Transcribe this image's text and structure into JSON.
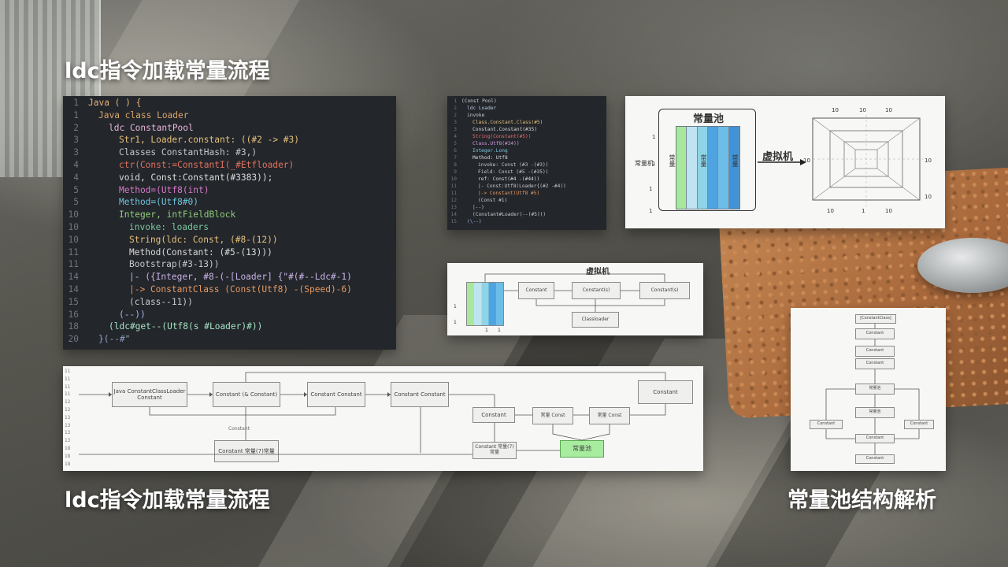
{
  "titles": {
    "top_left": "ldc指令加载常量流程",
    "bottom_left": "ldc指令加载常量流程",
    "bottom_right": "常量池结构解析"
  },
  "code_panel_main": {
    "lines": [
      {
        "num": "1",
        "text": "Java ( ) {",
        "indent": 0,
        "color": "#e0b37a"
      },
      {
        "num": "1",
        "text": "Java class Loader",
        "indent": 1,
        "color": "#d9a56c"
      },
      {
        "num": "2",
        "text": "ldc ConstantPool",
        "indent": 2,
        "color": "#e7b7d9"
      },
      {
        "num": "3",
        "text": "Str1, Loader.constant: ((#2 -> #3)",
        "indent": 3,
        "color": "#e6c07a"
      },
      {
        "num": "3",
        "text": "Classes ConstantHash: #3,)",
        "indent": 3,
        "color": "#c3c7cc"
      },
      {
        "num": "4",
        "text": "ctr(Const:=ConstantI(_#Etfloader)",
        "indent": 3,
        "color": "#e0715f"
      },
      {
        "num": "4",
        "text": "void, Const:Constant(#3383));",
        "indent": 3,
        "color": "#dcdcdc"
      },
      {
        "num": "5",
        "text": "Method=(Utf8(int)",
        "indent": 3,
        "color": "#d778c8"
      },
      {
        "num": "5",
        "text": "Method=(Utf8#0)",
        "indent": 3,
        "color": "#6fc3d9"
      },
      {
        "num": "10",
        "text": "Integer, intFieldBlock",
        "indent": 3,
        "color": "#8fcf7a"
      },
      {
        "num": "10",
        "text": "invoke: loaders",
        "indent": 4,
        "color": "#7cc7a0"
      },
      {
        "num": "10",
        "text": "String(ldc: Const, (#8-(12))",
        "indent": 4,
        "color": "#e6c07a"
      },
      {
        "num": "11",
        "text": "Method(Constant: (#5-(13)))",
        "indent": 4,
        "color": "#d9d9d9"
      },
      {
        "num": "11",
        "text": "Bootstrap(#3-13))",
        "indent": 4,
        "color": "#c9c9c9"
      },
      {
        "num": "14",
        "text": "|-  ({Integer, #8-(-[Loader] {\"#(#--Ldc#-1)",
        "indent": 4,
        "color": "#c8b2e6"
      },
      {
        "num": "14",
        "text": "|-> ConstantClass (Const(Utf8) -(Speed)-6)",
        "indent": 4,
        "color": "#e59a63"
      },
      {
        "num": "15",
        "text": "(class--11))",
        "indent": 4,
        "color": "#c9c9c9"
      },
      {
        "num": "16",
        "text": "(--))",
        "indent": 3,
        "color": "#9fb6e6"
      },
      {
        "num": "18",
        "text": "(ldc#get--(Utf8(s #Loader)#))",
        "indent": 2,
        "color": "#a6e3c4"
      },
      {
        "num": "20",
        "text": "}(--#\"",
        "indent": 1,
        "color": "#8fa3c6"
      }
    ]
  },
  "code_panel_small": {
    "lines": [
      {
        "num": "1",
        "text": "(Const Pool)",
        "indent": 0,
        "color": "#cfcfcf"
      },
      {
        "num": "2",
        "text": "ldc Loader",
        "indent": 1,
        "color": "#b9c7d9"
      },
      {
        "num": "2",
        "text": "invoke",
        "indent": 1,
        "color": "#c9c9c9"
      },
      {
        "num": "3",
        "text": "Class.Constant.Class(#5)",
        "indent": 2,
        "color": "#e3c27c"
      },
      {
        "num": "3",
        "text": "Constant.Constant(#35)",
        "indent": 2,
        "color": "#d9d9d9"
      },
      {
        "num": "4",
        "text": "String(Constant(#5))",
        "indent": 2,
        "color": "#e66f6f"
      },
      {
        "num": "5",
        "text": "Class.Utf8(#34))",
        "indent": 2,
        "color": "#d49be0"
      },
      {
        "num": "6",
        "text": "Integer.Long",
        "indent": 2,
        "color": "#7ec7e0"
      },
      {
        "num": "7",
        "text": "Method: Utf8",
        "indent": 2,
        "color": "#d9d9d9"
      },
      {
        "num": "8",
        "text": "invoke: Const (#3 -(#3))",
        "indent": 3,
        "color": "#c9c9c9"
      },
      {
        "num": "9",
        "text": "Field: Const (#5 -(#35))",
        "indent": 3,
        "color": "#c9c9c9"
      },
      {
        "num": "10",
        "text": "ref: Const(#4 -(#44))",
        "indent": 3,
        "color": "#d9d9d9"
      },
      {
        "num": "11",
        "text": "|-  Const:Utf8(Loader{(#2 -#4))",
        "indent": 3,
        "color": "#c9c9c9"
      },
      {
        "num": "11",
        "text": "|-> Constant(Utf8 #5)",
        "indent": 3,
        "color": "#e59a63"
      },
      {
        "num": "12",
        "text": "(Const #1)",
        "indent": 3,
        "color": "#c9c9c9"
      },
      {
        "num": "13",
        "text": "|--)",
        "indent": 2,
        "color": "#c9c9c9"
      },
      {
        "num": "14",
        "text": "(Constant#Loader(--(#5)))",
        "indent": 2,
        "color": "#c9c9c9"
      },
      {
        "num": "15",
        "text": "(\\--)",
        "indent": 1,
        "color": "#9fb6e6"
      }
    ]
  },
  "pool_panel": {
    "pool_title": "常量池",
    "vm_label": "虚拟机",
    "left_label": "常量机",
    "left_ticks": [
      "1",
      "1",
      "1",
      "1"
    ],
    "col_labels": [
      "常量",
      "常量",
      "常量"
    ],
    "columns": [
      "#a8e89c",
      "#bfe3f0",
      "#8fd4e6",
      "#4fa3e0",
      "#6cbde8",
      "#3f93d6"
    ],
    "grid_ticks_top": [
      "10",
      "10",
      "10"
    ],
    "grid_ticks_left": [
      "10"
    ],
    "grid_ticks_right": [
      "10",
      "10"
    ],
    "grid_ticks_bottom": [
      "10",
      "1",
      "10"
    ]
  },
  "mini_flow": {
    "title": "虚拟机",
    "blocks": [
      "Constant",
      "Constant(s)",
      "Constant(s)",
      "Classloader"
    ],
    "axis_ticks": [
      "1",
      "1",
      "1",
      "1"
    ]
  },
  "big_flow": {
    "row_numbers": [
      "11",
      "11",
      "11",
      "11",
      "12",
      "12",
      "13",
      "13",
      "13",
      "13",
      "18",
      "18",
      "18"
    ],
    "blocks": [
      "Java ConstantClassLoader Constant",
      "Constant (& Constant)",
      "Constant Constant",
      "Constant Constant",
      "Constant",
      "Constant",
      "常量 Const",
      "常量 Const",
      "Constant 常量(7)常量",
      "Constant 常量(7)常量",
      "常量池"
    ],
    "mid_label": "Constant"
  },
  "vertical_flow": {
    "blocks": [
      "[ConstantClass]",
      "Constant",
      "Constant",
      "Constant",
      "常量池",
      "常量池",
      "Constant",
      "Constant",
      "Constant",
      "Constant"
    ]
  }
}
